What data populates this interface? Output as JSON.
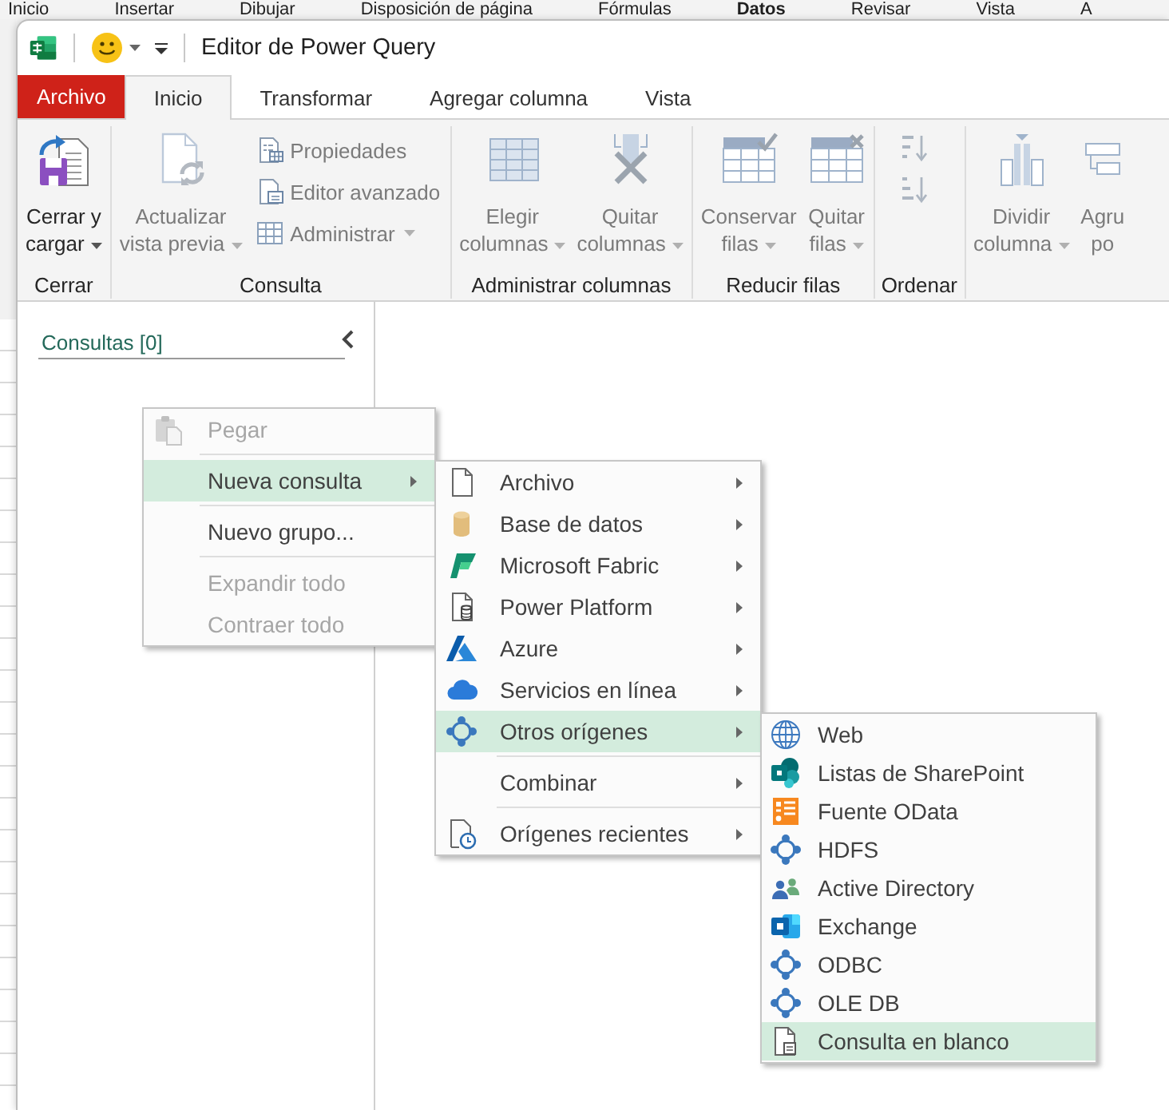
{
  "background_app": {
    "tabs": [
      {
        "label": "Inicio",
        "selected": false
      },
      {
        "label": "Insertar",
        "selected": false
      },
      {
        "label": "Dibujar",
        "selected": false
      },
      {
        "label": "Disposición de página",
        "selected": false
      },
      {
        "label": "Fórmulas",
        "selected": false
      },
      {
        "label": "Datos",
        "selected": true
      },
      {
        "label": "Revisar",
        "selected": false
      },
      {
        "label": "Vista",
        "selected": false
      },
      {
        "label": "A",
        "selected": false
      }
    ]
  },
  "window": {
    "title": "Editor de Power Query"
  },
  "tabs": [
    {
      "label": "Archivo",
      "kind": "file",
      "selected": false
    },
    {
      "label": "Inicio",
      "kind": "tab",
      "selected": true
    },
    {
      "label": "Transformar",
      "kind": "tab",
      "selected": false
    },
    {
      "label": "Agregar columna",
      "kind": "tab",
      "selected": false
    },
    {
      "label": "Vista",
      "kind": "tab",
      "selected": false
    }
  ],
  "ribbon": {
    "groups": [
      {
        "label": "Cerrar",
        "items": [
          {
            "kind": "large",
            "lines": [
              "Cerrar y",
              "cargar"
            ],
            "dropdown": true,
            "disabled": false
          }
        ]
      },
      {
        "label": "Consulta",
        "items": [
          {
            "kind": "large",
            "lines": [
              "Actualizar",
              "vista previa"
            ],
            "dropdown": true,
            "disabled": true
          },
          {
            "kind": "small",
            "label": "Propiedades",
            "dropdown": false,
            "disabled": true
          },
          {
            "kind": "small",
            "label": "Editor avanzado",
            "dropdown": false,
            "disabled": true
          },
          {
            "kind": "small",
            "label": "Administrar",
            "dropdown": true,
            "disabled": true
          }
        ]
      },
      {
        "label": "Administrar columnas",
        "items": [
          {
            "kind": "large",
            "lines": [
              "Elegir",
              "columnas"
            ],
            "dropdown": true,
            "disabled": true
          },
          {
            "kind": "large",
            "lines": [
              "Quitar",
              "columnas"
            ],
            "dropdown": true,
            "disabled": true
          }
        ]
      },
      {
        "label": "Reducir filas",
        "items": [
          {
            "kind": "large",
            "lines": [
              "Conservar",
              "filas"
            ],
            "dropdown": true,
            "disabled": true
          },
          {
            "kind": "large",
            "lines": [
              "Quitar",
              "filas"
            ],
            "dropdown": true,
            "disabled": true
          }
        ]
      },
      {
        "label": "Ordenar",
        "items": [
          {
            "kind": "icon",
            "disabled": true
          },
          {
            "kind": "icon",
            "disabled": true
          }
        ]
      },
      {
        "items": [
          {
            "kind": "large",
            "lines": [
              "Dividir",
              "columna"
            ],
            "dropdown": true,
            "disabled": true
          },
          {
            "kind": "large",
            "lines": [
              "Agru",
              "po"
            ],
            "dropdown": false,
            "disabled": true
          }
        ]
      }
    ]
  },
  "queries_pane": {
    "title": "Consultas [0]"
  },
  "context_menu": {
    "items": [
      {
        "kind": "item",
        "label": "Pegar",
        "disabled": true,
        "selected": false,
        "submenu": false
      },
      {
        "kind": "separator"
      },
      {
        "kind": "item",
        "label": "Nueva consulta",
        "disabled": false,
        "selected": true,
        "submenu": true
      },
      {
        "kind": "separator"
      },
      {
        "kind": "item",
        "label": "Nuevo grupo...",
        "disabled": false,
        "selected": false,
        "submenu": false
      },
      {
        "kind": "separator"
      },
      {
        "kind": "item",
        "label": "Expandir todo",
        "disabled": true,
        "selected": false,
        "submenu": false
      },
      {
        "kind": "item",
        "label": "Contraer todo",
        "disabled": true,
        "selected": false,
        "submenu": false
      }
    ]
  },
  "new_query_submenu": {
    "items": [
      {
        "kind": "item",
        "label": "Archivo",
        "selected": false,
        "submenu": true
      },
      {
        "kind": "item",
        "label": "Base de datos",
        "selected": false,
        "submenu": true
      },
      {
        "kind": "item",
        "label": "Microsoft Fabric",
        "selected": false,
        "submenu": true
      },
      {
        "kind": "item",
        "label": "Power Platform",
        "selected": false,
        "submenu": true
      },
      {
        "kind": "item",
        "label": "Azure",
        "selected": false,
        "submenu": true
      },
      {
        "kind": "item",
        "label": "Servicios en línea",
        "selected": false,
        "submenu": true
      },
      {
        "kind": "item",
        "label": "Otros orígenes",
        "selected": true,
        "submenu": true
      },
      {
        "kind": "separator"
      },
      {
        "kind": "item",
        "label": "Combinar",
        "selected": false,
        "submenu": true
      },
      {
        "kind": "separator"
      },
      {
        "kind": "item",
        "label": "Orígenes recientes",
        "selected": false,
        "submenu": true
      }
    ]
  },
  "other_sources_submenu": {
    "items": [
      {
        "kind": "item",
        "label": "Web",
        "selected": false
      },
      {
        "kind": "item",
        "label": "Listas de SharePoint",
        "selected": false
      },
      {
        "kind": "item",
        "label": "Fuente OData",
        "selected": false
      },
      {
        "kind": "item",
        "label": "HDFS",
        "selected": false
      },
      {
        "kind": "item",
        "label": "Active Directory",
        "selected": false
      },
      {
        "kind": "item",
        "label": "Exchange",
        "selected": false
      },
      {
        "kind": "item",
        "label": "ODBC",
        "selected": false
      },
      {
        "kind": "item",
        "label": "OLE DB",
        "selected": false
      },
      {
        "kind": "item",
        "label": "Consulta en blanco",
        "selected": true
      }
    ]
  }
}
